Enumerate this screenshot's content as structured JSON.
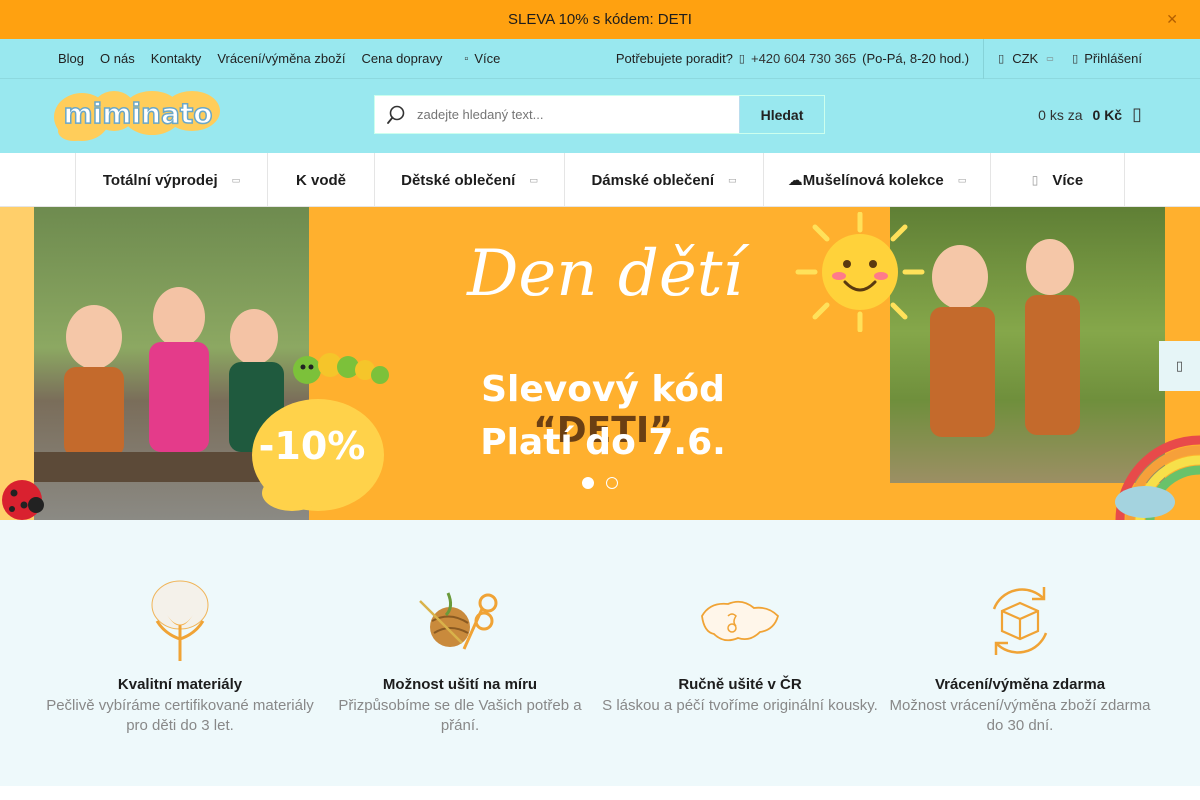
{
  "promo": {
    "text": "SLEVA 10% s kódem: DETI",
    "close_icon": "close-icon"
  },
  "topbar": {
    "links": [
      "Blog",
      "O nás",
      "Kontakty",
      "Vrácení/výměna zboží",
      "Cena dopravy"
    ],
    "more": "Více",
    "help_label": "Potřebujete poradit?",
    "phone": "+420 604 730 365",
    "hours": "(Po-Pá, 8-20 hod.)",
    "currency": "CZK",
    "login": "Přihlášení"
  },
  "header": {
    "logo_text": "miminato",
    "search_placeholder": "zadejte hledaný text...",
    "search_button": "Hledat",
    "cart_count": "0 ks za",
    "cart_total": "0 Kč"
  },
  "nav": {
    "items": [
      "Totální výprodej",
      "K vodě",
      "Dětské oblečení",
      "Dámské oblečení",
      "☁Mušelínová kolekce",
      "Více"
    ]
  },
  "hero": {
    "title": "Den dětí",
    "line1_prefix": "Slevový kód ",
    "line1_code": "“DETI”",
    "line2": "Platí do 7.6.",
    "badge": "-10%",
    "slides": 2,
    "active_slide": 1
  },
  "benefits": [
    {
      "title": "Kvalitní materiály",
      "desc": "Pečlivě vybíráme certifikované materiály pro děti do 3 let.",
      "icon": "cotton-flower-icon"
    },
    {
      "title": "Možnost ušití na míru",
      "desc": "Přizpůsobíme se dle Vašich potřeb a přání.",
      "icon": "sewing-yarn-scissors-icon"
    },
    {
      "title": "Ručně ušité v ČR",
      "desc": "S láskou a péčí tvoříme originální kousky.",
      "icon": "czech-map-icon"
    },
    {
      "title": "Vrácení/výměna zdarma",
      "desc": "Možnost vrácení/výměna zboží zdarma do 30 dní.",
      "icon": "return-box-icon"
    }
  ],
  "colors": {
    "promo": "#ffa110",
    "header": "#99e8ef",
    "hero": "#ffb02e",
    "benefits_bg": "#eef9fb"
  }
}
